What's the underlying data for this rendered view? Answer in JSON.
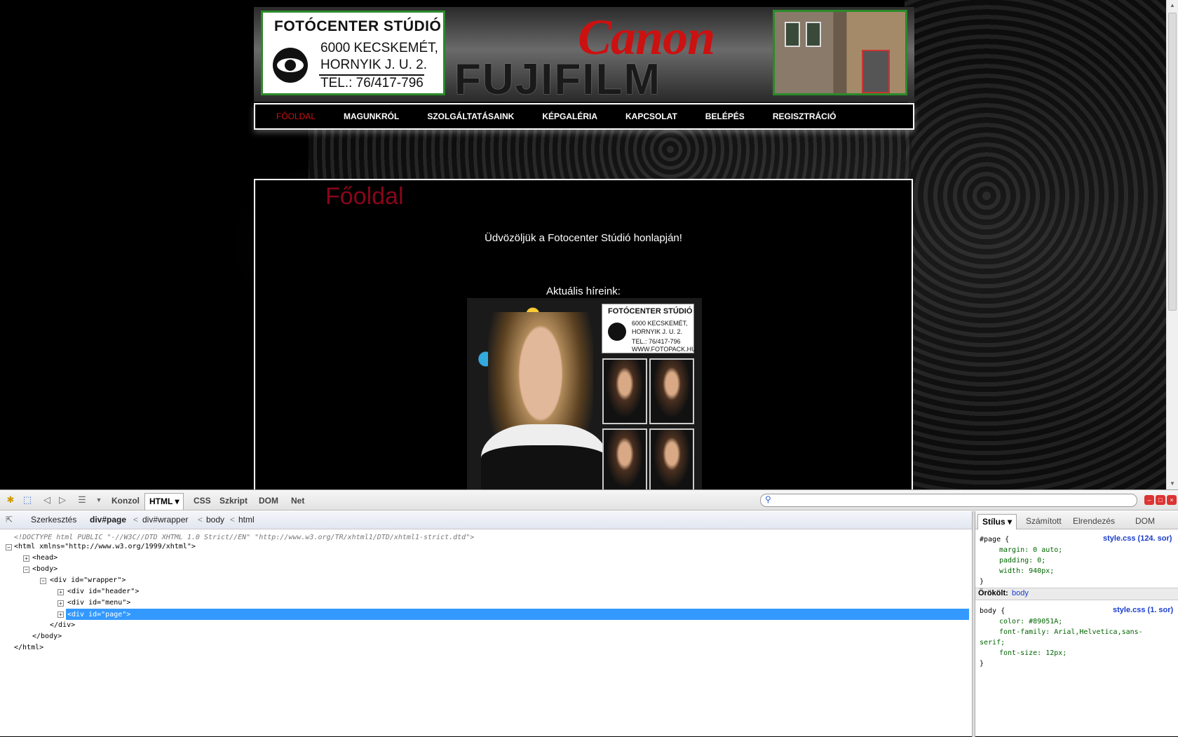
{
  "site": {
    "logo": {
      "title": "FOTÓCENTER STÚDIÓ",
      "line1": "6000 KECSKEMÉT,",
      "line2": "HORNYIK J. U. 2.",
      "line3": "TEL.: 76/417-796"
    },
    "brand1": "Canon",
    "brand2": "FUJIFILM",
    "menu": [
      "FŐOLDAL",
      "MAGUNKRÓL",
      "SZOLGÁLTATÁSAINK",
      "KÉPGALÉRIA",
      "KAPCSOLAT",
      "BELÉPÉS",
      "REGISZTRÁCIÓ"
    ],
    "page_title": "Főoldal",
    "welcome": "Üdvözöljük a Fotocenter Stúdió honlapján!",
    "news_heading": "Aktuális híreink:",
    "poster_logo": {
      "title": "FOTÓCENTER STÚDIÓ",
      "line1": "6000 KECSKEMÉT,",
      "line2": "HORNYIK J. U. 2.",
      "line3": "TEL.: 76/417-796",
      "line4": "WWW.FOTOPACK.HU"
    }
  },
  "devtools": {
    "tabs": [
      "Konzol",
      "HTML",
      "CSS",
      "Szkript",
      "DOM",
      "Net"
    ],
    "active_tab": "HTML",
    "crumbs": {
      "edit": "Szerkesztés",
      "items": [
        "div#page",
        "div#wrapper",
        "body",
        "html"
      ]
    },
    "side_tabs": [
      "Stílus",
      "Számított",
      "Elrendezés",
      "DOM"
    ],
    "html_lines": {
      "doctype": "<!DOCTYPE html PUBLIC \"-//W3C//DTD XHTML 1.0 Strict//EN\" \"http://www.w3.org/TR/xhtml1/DTD/xhtml1-strict.dtd\">",
      "html_open": "<html xmlns=\"http://www.w3.org/1999/xhtml\">",
      "head": "<head>",
      "body_open": "<body>",
      "wrapper_open": "<div id=\"wrapper\">",
      "header": "<div id=\"header\">",
      "menu": "<div id=\"menu\">",
      "page": "<div id=\"page\">",
      "div_close": "</div>",
      "body_close": "</body>",
      "html_close": "</html>"
    },
    "css": {
      "rule1_selector": "#page {",
      "rule1_source": "style.css (124. sor)",
      "rule1_props": [
        "margin: 0 auto;",
        "padding: 0;",
        "width: 940px;"
      ],
      "close": "}",
      "inherited_label": "Örökölt:",
      "inherited_from": "body",
      "rule2_selector": "body {",
      "rule2_source": "style.css (1. sor)",
      "rule2_props": [
        "color: #89051A;",
        "font-family: Arial,Helvetica,sans-",
        "serif;",
        "font-size: 12px;"
      ]
    }
  },
  "colors": {
    "accent_red": "#89051A",
    "menu_active": "#cc1111",
    "selection": "#3399ff",
    "logo_border": "#2a8a2a"
  }
}
